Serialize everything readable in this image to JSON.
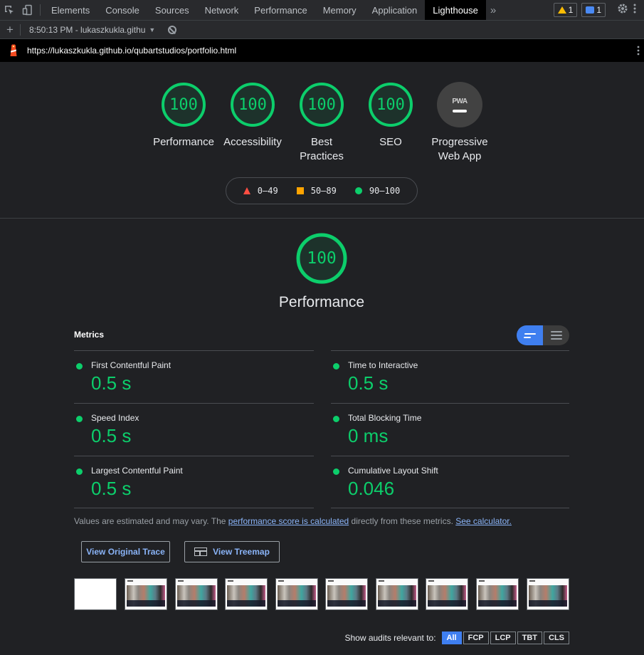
{
  "devtools": {
    "tabs": [
      "Elements",
      "Console",
      "Sources",
      "Network",
      "Performance",
      "Memory",
      "Application",
      "Lighthouse"
    ],
    "active_tab": "Lighthouse",
    "more_tabs_glyph": "»",
    "warnings_count": "1",
    "messages_count": "1"
  },
  "report_bar": {
    "add_glyph": "+",
    "report_label": "8:50:13 PM - lukaszkukla.githu",
    "caret": "▼"
  },
  "url_bar": {
    "url": "https://lukaszkukla.github.io/qubartstudios/portfolio.html"
  },
  "categories": [
    {
      "label": "Performance",
      "score": "100",
      "fill": 1.0
    },
    {
      "label": "Accessibility",
      "score": "100",
      "fill": 1.0
    },
    {
      "label": "Best Practices",
      "score": "100",
      "fill": 1.0
    },
    {
      "label": "SEO",
      "score": "100",
      "fill": 1.0
    },
    {
      "label": "Progressive Web App",
      "badge": "PWA"
    }
  ],
  "legend": {
    "fail": "0–49",
    "average": "50–89",
    "pass": "90–100"
  },
  "colors": {
    "pass": "#0cce6b",
    "average": "#ffa400",
    "fail": "#ff4e42",
    "accent": "#3f7ff0",
    "link": "#8ab4f8"
  },
  "performance": {
    "score": "100",
    "fill": 1.0,
    "title": "Performance",
    "metrics_heading": "Metrics",
    "metrics": [
      {
        "title": "First Contentful Paint",
        "value": "0.5 s"
      },
      {
        "title": "Time to Interactive",
        "value": "0.5 s"
      },
      {
        "title": "Speed Index",
        "value": "0.5 s"
      },
      {
        "title": "Total Blocking Time",
        "value": "0 ms"
      },
      {
        "title": "Largest Contentful Paint",
        "value": "0.5 s"
      },
      {
        "title": "Cumulative Layout Shift",
        "value": "0.046"
      }
    ],
    "note_prefix": "Values are estimated and may vary. The ",
    "note_link1": "performance score is calculated",
    "note_middle": " directly from these metrics. ",
    "note_link2": "See calculator.",
    "trace_button": "View Original Trace",
    "treemap_button": "View Treemap"
  },
  "filter": {
    "label": "Show audits relevant to:",
    "chips": [
      "All",
      "FCP",
      "LCP",
      "TBT",
      "CLS"
    ],
    "active": "All"
  }
}
